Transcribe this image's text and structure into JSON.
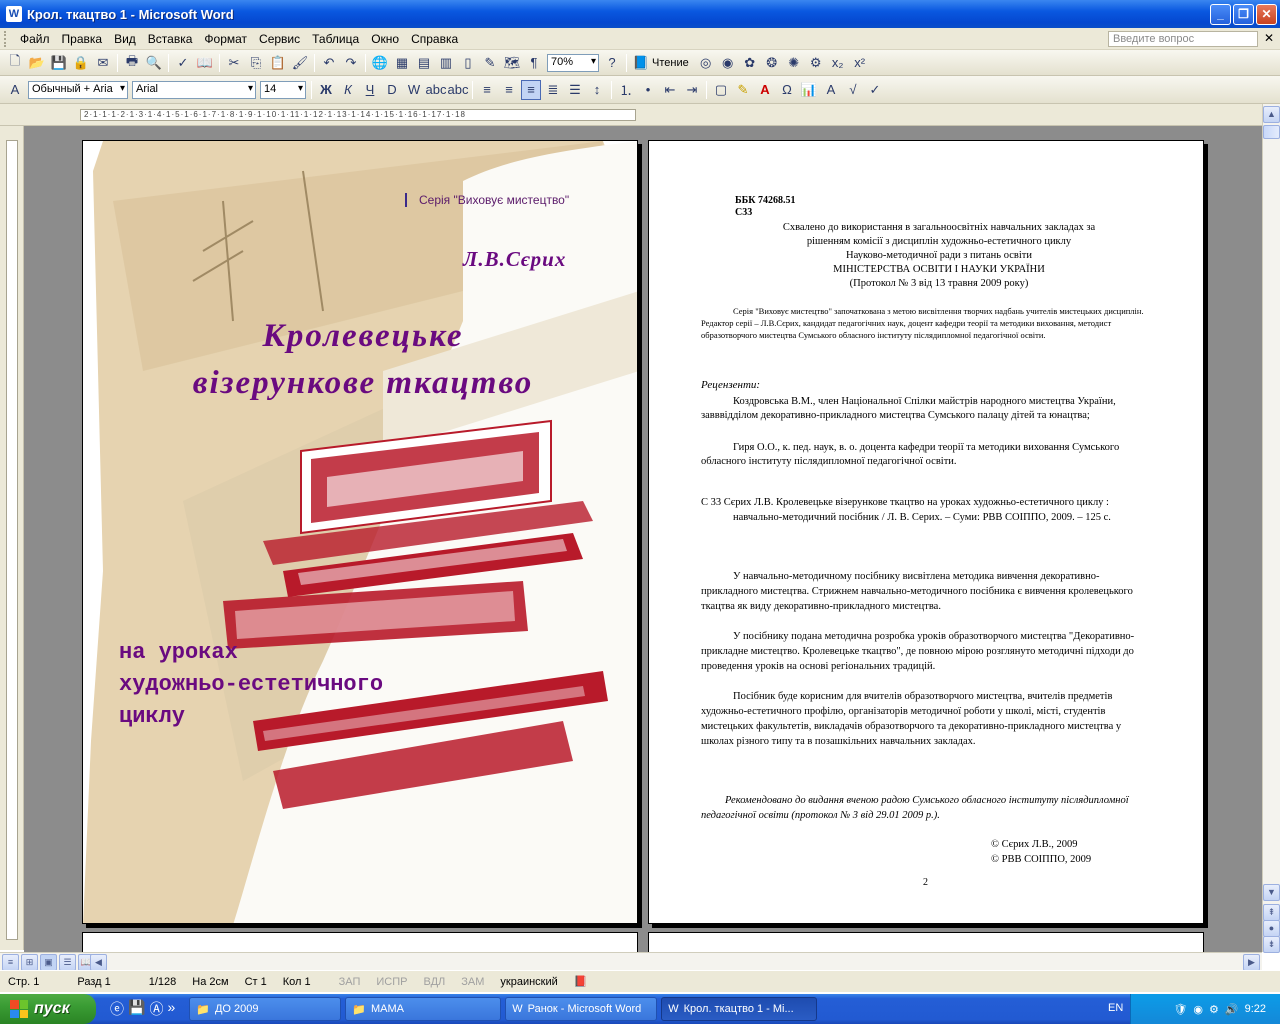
{
  "window": {
    "title": "Крол. ткацтво 1 - Microsoft Word"
  },
  "menu": {
    "items": [
      "Файл",
      "Правка",
      "Вид",
      "Вставка",
      "Формат",
      "Сервис",
      "Таблица",
      "Окно",
      "Справка"
    ],
    "help_placeholder": "Введите вопрос"
  },
  "toolbar": {
    "zoom": "70%",
    "reading_label": "Чтение"
  },
  "format_toolbar": {
    "style": "Обычный + Aria",
    "font": "Arial",
    "size": "14"
  },
  "ruler": {
    "text": "2·1·1·1·2·1·3·1·4·1·5·1·6·1·7·1·8·1·9·1·10·1·11·1·12·1·13·1·14·1·15·1·16·1·17·1·18"
  },
  "cover": {
    "series": "Серія \"Виховує мистецтво\"",
    "author": "Л.В.Сєрих",
    "title_line1": "Кролевецьке",
    "title_line2": "візерункове ткацтво",
    "sub1": "на уроках",
    "sub2": "художньо-естетичного",
    "sub3": "циклу"
  },
  "page2": {
    "bbk": "ББК 74268.51",
    "c33": "С33",
    "approval": [
      "Схвалено до використання в загальноосвітніх навчальних закладах за",
      "рішенням комісії з дисциплін художньо-естетичного циклу",
      "Науково-методичної ради з питань освіти",
      "МІНІСТЕРСТВА ОСВІТИ І НАУКИ УКРАЇНИ",
      "(Протокол № 3 від 13 травня 2009 року)"
    ],
    "series_intro": "Серія \"Виховує мистецтво\" започаткована з метою висвітлення творчих надбань учителів мистецьких дисциплін. Редактор серії – Л.В.Сєрих, кандидат педагогічних наук, доцент кафедри теорії та методики виховання, методист образотворчого мистецтва Сумського обласного інституту післядипломної педагогічної освіти.",
    "reviewers_heading": "Рецензенти:",
    "reviewer1": "Коздровська В.М., член Національної Спілки майстрів народного мистецтва України, завввідділом декоративно-прикладного мистецтва Сумського палацу дітей та юнацтва;",
    "reviewer2": "Гиря О.О., к. пед. наук, в. о. доцента кафедри теорії та методики виховання Сумського обласного інституту післядипломної педагогічної освіти.",
    "citation": "С 33 Сєрих Л.В. Кролевецьке візерункове ткацтво на уроках художньо-естетичного циклу : навчально-методичний посібник / Л. В. Серих. – Суми: РВВ СОІППО, 2009. – 125 с.",
    "abstract1": "У навчально-методичному посібнику висвітлена методика вивчення декоративно-прикладного мистецтва. Стрижнем навчально-методичного посібника є вивчення кролевецького ткацтва як виду декоративно-прикладного мистецтва.",
    "abstract2": "У посібнику подана методична розробка уроків образотворчого мистецтва \"Декоративно-прикладне мистецтво. Кролевецьке ткацтво\", де повною мірою розглянуто методичні підходи до проведення уроків на основі регіональних традицій.",
    "abstract3": "Посібник буде корисним для вчителів образотворчого мистецтва, вчителів предметів художньо-естетичного профілю, організаторів методичної роботи у школі, місті, студентів мистецьких факультетів, викладачів образотворчого та декоративно-прикладного мистецтва у школах різного типу та в позашкільних навчальних закладах.",
    "recommend": "Рекомендовано до видання вченою радою Сумського обласного інституту післядипломної педагогічної освіти (протокол № 3 від 29.01 2009 р.).",
    "copyright1": "© Сєрих Л.В., 2009",
    "copyright2": "© РВВ СОІППО, 2009",
    "page_number": "2"
  },
  "status": {
    "page": "Стр. 1",
    "section": "Разд 1",
    "pages": "1/128",
    "at": "На 2см",
    "line": "Ст 1",
    "col": "Кол 1",
    "rec": "ЗАП",
    "trk": "ИСПР",
    "ext": "ВДЛ",
    "ovr": "ЗАМ",
    "lang": "украинский"
  },
  "taskbar": {
    "start": "пуск",
    "buttons": [
      "ДО 2009",
      "МАМА",
      "Ранок - Microsoft Word",
      "Крол. ткацтво 1 - Mi..."
    ],
    "lang": "EN",
    "time": "9:22"
  },
  "colors": {
    "cover_text": "#6a0a80",
    "titlebar": "#0548d0",
    "start": "#3a9c34"
  }
}
